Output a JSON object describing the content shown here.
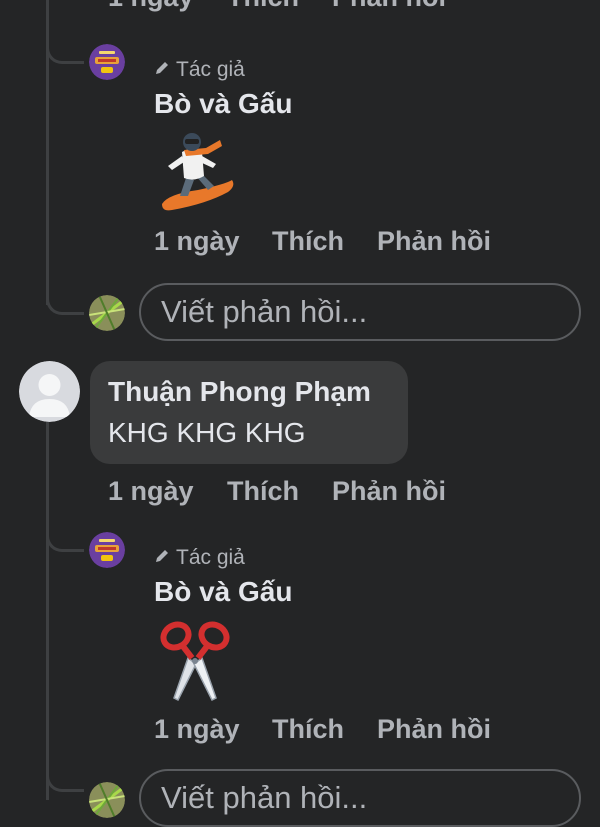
{
  "actions": {
    "time": "1 ngày",
    "like": "Thích",
    "reply": "Phản hồi"
  },
  "author_badge": "Tác giả",
  "reply_placeholder": "Viết phản hồi...",
  "comments": [
    {
      "type": "reply",
      "author": "Bò và Gấu",
      "is_author": true,
      "sticker": "snowboarder"
    },
    {
      "type": "comment",
      "author": "Thuận Phong Phạm",
      "text": "KHG KHG KHG"
    },
    {
      "type": "reply",
      "author": "Bò và Gấu",
      "is_author": true,
      "sticker": "scissors"
    }
  ],
  "colors": {
    "background": "#242526",
    "bubble": "#3a3b3c",
    "text_primary": "#e4e6eb",
    "text_secondary": "#b0b3b8",
    "page_avatar": "#6a3fa0"
  }
}
